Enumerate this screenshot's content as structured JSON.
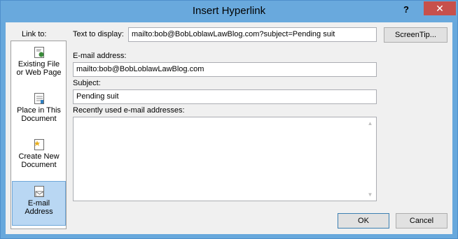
{
  "window": {
    "title": "Insert Hyperlink",
    "help": "?",
    "close": "✕"
  },
  "link_to": {
    "label": "Link to:",
    "items": [
      {
        "line1": "Existing File",
        "line2": "or Web Page",
        "icon": "web-page-icon",
        "selected": false
      },
      {
        "line1": "Place in This",
        "line2": "Document",
        "icon": "document-place-icon",
        "selected": false
      },
      {
        "line1": "Create New",
        "line2": "Document",
        "icon": "new-document-icon",
        "selected": false
      },
      {
        "line1": "E-mail",
        "line2": "Address",
        "icon": "email-address-icon",
        "selected": true
      }
    ]
  },
  "text_to_display": {
    "label": "Text to display:",
    "value": "mailto:bob@BobLoblawLawBlog.com?subject=Pending suit"
  },
  "screentip_button": "ScreenTip...",
  "email_address": {
    "label": "E-mail address:",
    "value": "mailto:bob@BobLoblawLawBlog.com"
  },
  "subject": {
    "label": "Subject:",
    "value": "Pending suit"
  },
  "recent": {
    "label": "Recently used e-mail addresses:",
    "items": []
  },
  "buttons": {
    "ok": "OK",
    "cancel": "Cancel"
  }
}
